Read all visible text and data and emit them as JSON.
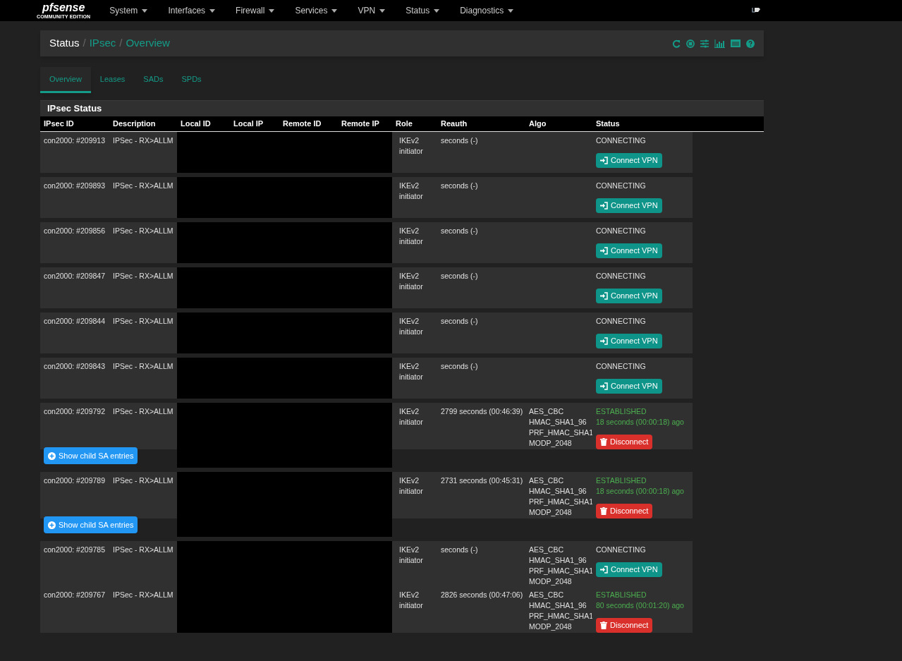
{
  "navbar": {
    "logo": "pfsense",
    "edition": "COMMUNITY EDITION",
    "menus": [
      "System",
      "Interfaces",
      "Firewall",
      "Services",
      "VPN",
      "Status",
      "Diagnostics"
    ]
  },
  "breadcrumb": [
    "Status",
    "IPsec",
    "Overview"
  ],
  "breadcrumb_separator": "/",
  "tabs": [
    {
      "label": "Overview",
      "selected": true
    },
    {
      "label": "Leases",
      "selected": false
    },
    {
      "label": "SADs",
      "selected": false
    },
    {
      "label": "SPDs",
      "selected": false
    }
  ],
  "panel": {
    "title": "IPsec Status",
    "columns": [
      "IPsec ID",
      "Description",
      "Local ID",
      "Local IP",
      "Remote ID",
      "Remote IP",
      "Role",
      "Reauth",
      "Algo",
      "Status"
    ],
    "rows": [
      {
        "id": "con2000: #209913",
        "description": "IPSec - RX>ALLM",
        "role": [
          "IKEv2",
          "initiator"
        ],
        "reauth": "seconds (-)",
        "algo": [],
        "kind": "connecting",
        "status": "CONNECTING",
        "button": "Connect VPN"
      },
      {
        "id": "con2000: #209893",
        "description": "IPSec - RX>ALLM",
        "role": [
          "IKEv2",
          "initiator"
        ],
        "reauth": "seconds (-)",
        "algo": [],
        "kind": "connecting",
        "status": "CONNECTING",
        "button": "Connect VPN"
      },
      {
        "id": "con2000: #209856",
        "description": "IPSec - RX>ALLM",
        "role": [
          "IKEv2",
          "initiator"
        ],
        "reauth": "seconds (-)",
        "algo": [],
        "kind": "connecting",
        "status": "CONNECTING",
        "button": "Connect VPN"
      },
      {
        "id": "con2000: #209847",
        "description": "IPSec - RX>ALLM",
        "role": [
          "IKEv2",
          "initiator"
        ],
        "reauth": "seconds (-)",
        "algo": [],
        "kind": "connecting",
        "status": "CONNECTING",
        "button": "Connect VPN"
      },
      {
        "id": "con2000: #209844",
        "description": "IPSec - RX>ALLM",
        "role": [
          "IKEv2",
          "initiator"
        ],
        "reauth": "seconds (-)",
        "algo": [],
        "kind": "connecting",
        "status": "CONNECTING",
        "button": "Connect VPN"
      },
      {
        "id": "con2000: #209843",
        "description": "IPSec - RX>ALLM",
        "role": [
          "IKEv2",
          "initiator"
        ],
        "reauth": "seconds (-)",
        "algo": [],
        "kind": "connecting",
        "status": "CONNECTING",
        "button": "Connect VPN"
      },
      {
        "id": "con2000: #209792",
        "description": "IPSec - RX>ALLM",
        "role": [
          "IKEv2",
          "initiator"
        ],
        "reauth": "2799 seconds (00:46:39)",
        "algo": [
          "AES_CBC",
          "HMAC_SHA1_96",
          "PRF_HMAC_SHA1",
          "MODP_2048"
        ],
        "kind": "established",
        "status": "ESTABLISHED",
        "since": "18 seconds (00:00:18) ago",
        "button": "Disconnect",
        "child_button": "Show child SA entries"
      },
      {
        "id": "con2000: #209789",
        "description": "IPSec - RX>ALLM",
        "role": [
          "IKEv2",
          "initiator"
        ],
        "reauth": "2731 seconds (00:45:31)",
        "algo": [
          "AES_CBC",
          "HMAC_SHA1_96",
          "PRF_HMAC_SHA1",
          "MODP_2048"
        ],
        "kind": "established",
        "status": "ESTABLISHED",
        "since": "18 seconds (00:00:18) ago",
        "button": "Disconnect",
        "child_button": "Show child SA entries"
      },
      {
        "id": "con2000: #209785",
        "description": "IPSec - RX>ALLM",
        "role": [
          "IKEv2",
          "initiator"
        ],
        "reauth": "seconds (-)",
        "algo": [
          "AES_CBC",
          "HMAC_SHA1_96",
          "PRF_HMAC_SHA1",
          "MODP_2048"
        ],
        "kind": "connecting",
        "status": "CONNECTING",
        "button": "Connect VPN"
      },
      {
        "id": "con2000: #209767",
        "description": "IPSec - RX>ALLM",
        "role": [
          "IKEv2",
          "initiator"
        ],
        "reauth": "2826 seconds (00:47:06)",
        "algo": [
          "AES_CBC",
          "HMAC_SHA1_96",
          "PRF_HMAC_SHA1",
          "MODP_2048"
        ],
        "kind": "established",
        "status": "ESTABLISHED",
        "since": "80 seconds (00:01:20) ago",
        "button": "Disconnect"
      }
    ]
  }
}
